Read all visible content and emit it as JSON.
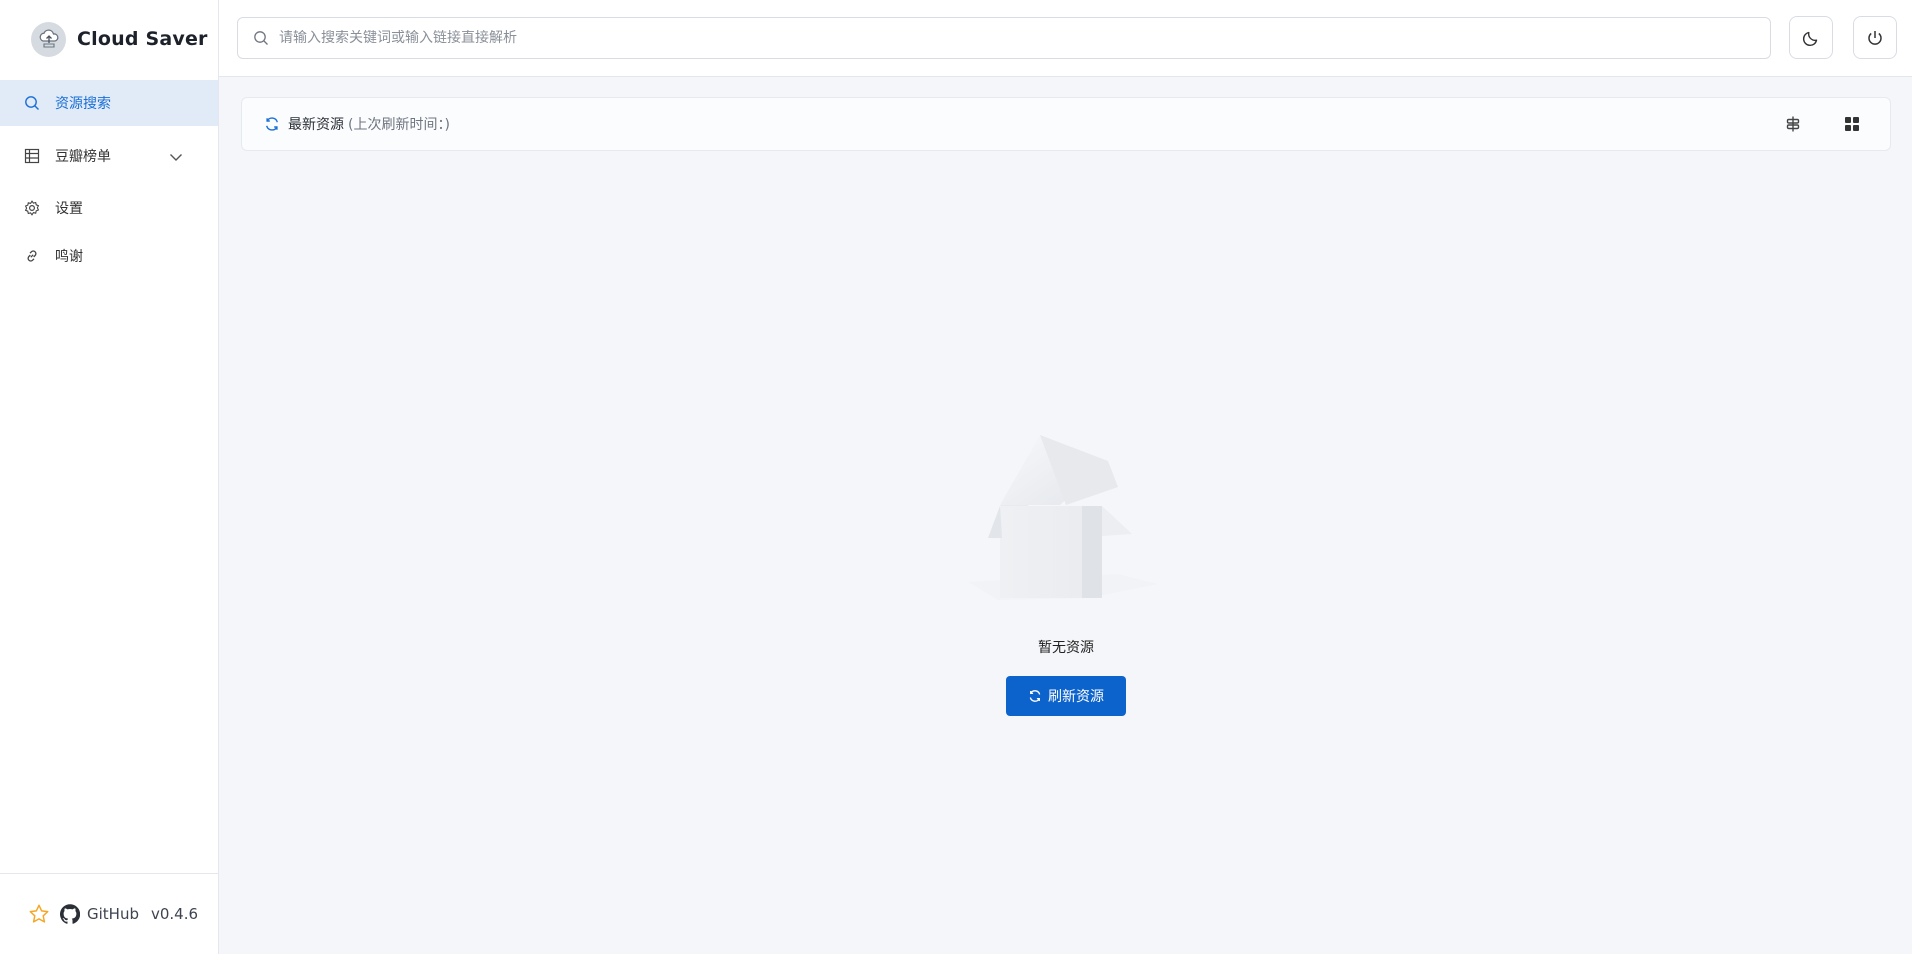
{
  "app": {
    "title": "Cloud Saver"
  },
  "sidebar": {
    "items": [
      {
        "label": "资源搜索",
        "icon": "search-icon",
        "active": true
      },
      {
        "label": "豆瓣榜单",
        "icon": "grid-table-icon",
        "expandable": true
      },
      {
        "label": "设置",
        "icon": "gear-icon"
      },
      {
        "label": "鸣谢",
        "icon": "link-icon"
      }
    ],
    "footer": {
      "star_icon": "star-icon",
      "github_label": "GitHub",
      "version": "v0.4.6"
    }
  },
  "header": {
    "search": {
      "placeholder": "请输入搜索关键词或输入链接直接解析",
      "value": ""
    },
    "actions": [
      "moon-icon",
      "power-icon"
    ]
  },
  "latest": {
    "title": "最新资源",
    "subtitle": "(上次刷新时间：)",
    "tools": [
      "filter-settings-icon",
      "grid-view-icon"
    ]
  },
  "empty_state": {
    "message": "暂无资源",
    "button_label": "刷新资源"
  },
  "colors": {
    "accent": "#0d63cc",
    "active_bg": "#e1ebf7",
    "star": "#f5a623",
    "page_bg": "#f4f6f9"
  }
}
